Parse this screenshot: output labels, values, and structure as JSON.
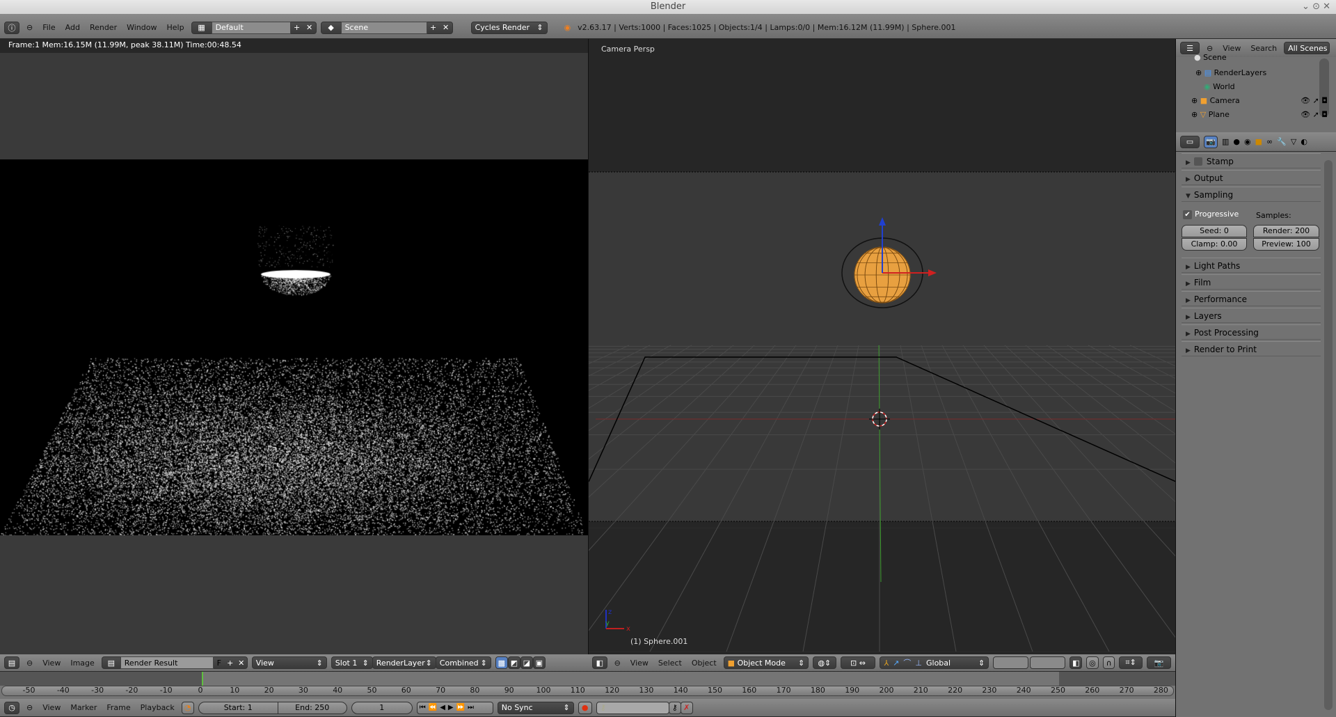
{
  "window": {
    "title": "Blender"
  },
  "top_header": {
    "menus": [
      "File",
      "Add",
      "Render",
      "Window",
      "Help"
    ],
    "layout": "Default",
    "scene": "Scene",
    "engine": "Cycles Render",
    "stats": "v2.63.17 | Verts:1000 | Faces:1025 | Objects:1/4 | Lamps:0/0 | Mem:16.12M (11.99M) | Sphere.001"
  },
  "image_editor": {
    "render_info": "Frame:1 Mem:16.15M (11.99M, peak 38.11M) Time:00:48.54",
    "header": {
      "menus": [
        "View",
        "Image"
      ],
      "image": "Render Result",
      "fake_user": "F",
      "view": "View",
      "slot": "Slot 1",
      "layer": "RenderLayer",
      "pass": "Combined"
    }
  },
  "viewport": {
    "label": "Camera Persp",
    "object_label": "(1) Sphere.001",
    "axes": {
      "x": "x",
      "y": "y",
      "z": "z"
    },
    "header": {
      "menus": [
        "View",
        "Select",
        "Object"
      ],
      "mode": "Object Mode",
      "orientation": "Global"
    }
  },
  "outliner": {
    "menus": [
      "View",
      "Search"
    ],
    "filter": "All Scenes",
    "items": [
      {
        "label": "Scene"
      },
      {
        "label": "RenderLayers"
      },
      {
        "label": "World"
      },
      {
        "label": "Camera"
      },
      {
        "label": "Plane"
      }
    ]
  },
  "properties": {
    "panels": {
      "stamp": "Stamp",
      "output": "Output",
      "sampling": "Sampling",
      "light_paths": "Light Paths",
      "film": "Film",
      "performance": "Performance",
      "layers": "Layers",
      "post_processing": "Post Processing",
      "render_to_print": "Render to Print"
    },
    "sampling": {
      "progressive": "Progressive",
      "progressive_checked": true,
      "samples_label": "Samples:",
      "seed": "Seed: 0",
      "clamp": "Clamp: 0.00",
      "render": "Render: 200",
      "preview": "Preview: 100"
    }
  },
  "timeline": {
    "ticks": [
      "-50",
      "-40",
      "-30",
      "-20",
      "-10",
      "0",
      "10",
      "20",
      "30",
      "40",
      "50",
      "60",
      "70",
      "80",
      "90",
      "100",
      "110",
      "120",
      "130",
      "140",
      "150",
      "160",
      "170",
      "180",
      "190",
      "200",
      "210",
      "220",
      "230",
      "240",
      "250",
      "260",
      "270",
      "280"
    ],
    "current_frame": 1,
    "header": {
      "menus": [
        "View",
        "Marker",
        "Frame",
        "Playback"
      ],
      "start": "Start: 1",
      "end": "End: 250",
      "frame": "1",
      "sync": "No Sync"
    }
  },
  "colors": {
    "accent_orange": "#f0a030",
    "frame_green": "#5fbf3f",
    "x_axis": "#c02020",
    "y_axis": "#30a030",
    "z_axis": "#2030c0"
  }
}
